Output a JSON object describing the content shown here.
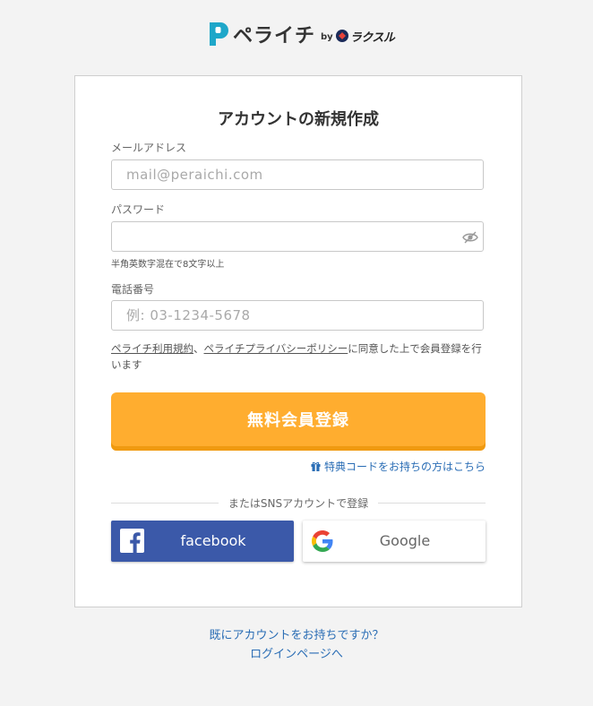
{
  "header": {
    "brand": "ペライチ",
    "by": "by",
    "partner": "ラクスル"
  },
  "form": {
    "title": "アカウントの新規作成",
    "email": {
      "label": "メールアドレス",
      "placeholder": "mail@peraichi.com",
      "value": ""
    },
    "password": {
      "label": "パスワード",
      "value": "",
      "hint": "半角英数字混在で8文字以上"
    },
    "phone": {
      "label": "電話番号",
      "placeholder": "例: 03-1234-5678",
      "value": ""
    },
    "terms": {
      "link1": "ペライチ利用規約",
      "sep": "、",
      "link2": "ペライチプライバシーポリシー",
      "text": "に同意した上で会員登録を行います"
    },
    "submit_label": "無料会員登録",
    "special_code_link": "特典コードをお持ちの方はこちら",
    "sns_divider": "またはSNSアカウントで登録",
    "facebook_label": "facebook",
    "google_label": "Google"
  },
  "footer": {
    "login_line1": "既にアカウントをお持ちですか？",
    "login_line2": "ログインページへ"
  },
  "colors": {
    "accent": "#ffad2f",
    "link": "#2a6db5",
    "facebook": "#3b59a9",
    "brand": "#1ea7c9"
  }
}
